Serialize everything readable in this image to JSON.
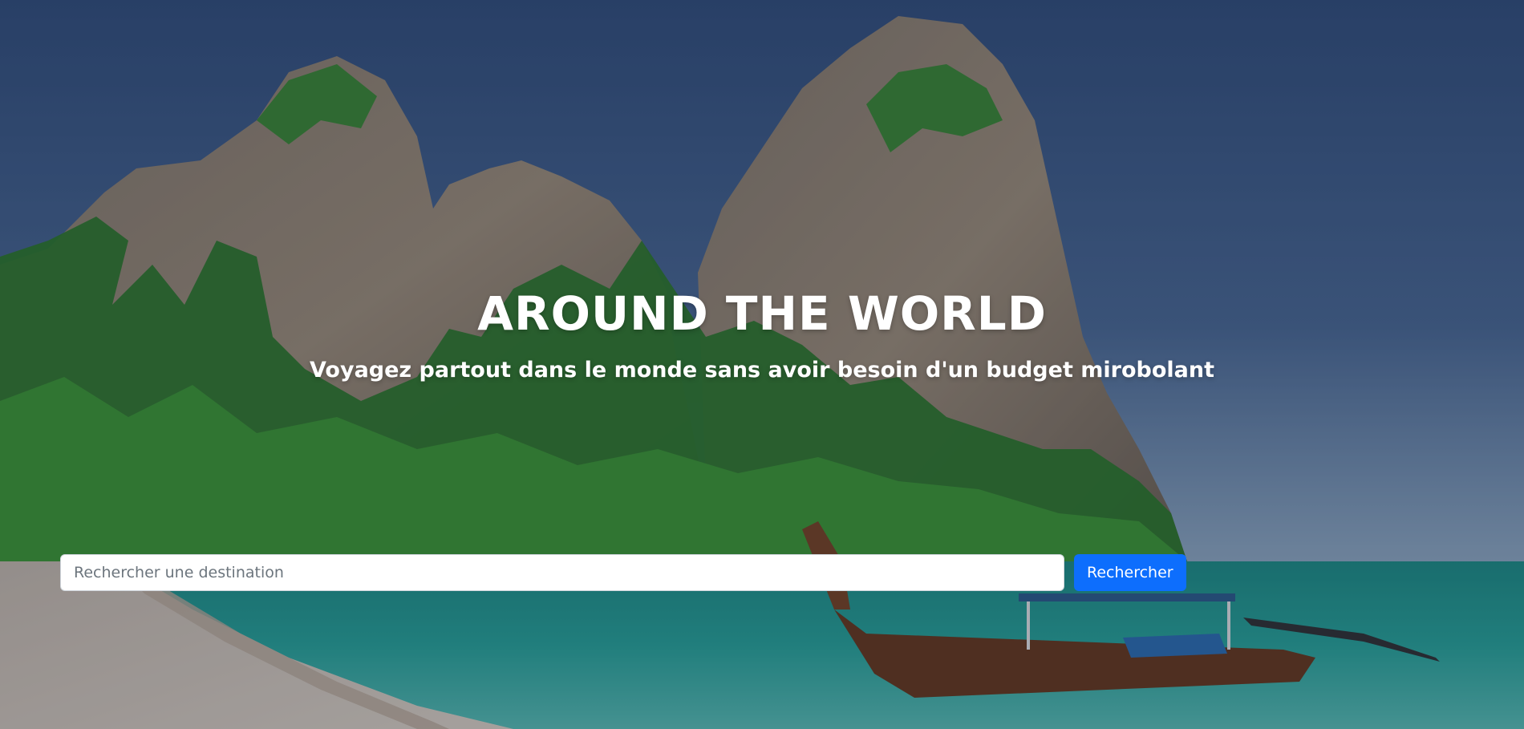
{
  "hero": {
    "title": "AROUND THE WORLD",
    "subtitle": "Voyagez partout dans le monde sans avoir besoin d'un budget mirobolant",
    "background": "tropical-beach-limestone-cliffs-longtail-boat"
  },
  "search": {
    "placeholder": "Rechercher une destination",
    "value": "",
    "button_label": "Rechercher"
  },
  "colors": {
    "accent": "#0d6efd",
    "text_on_hero": "#ffffff"
  }
}
